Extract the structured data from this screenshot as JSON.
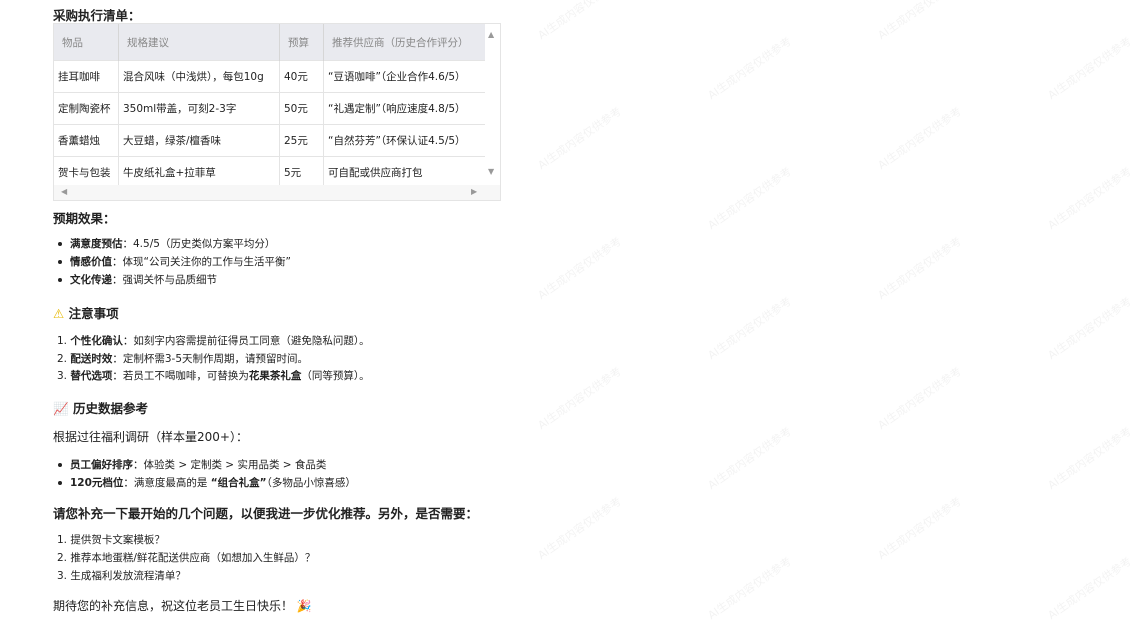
{
  "watermark": "AI生成内容仅供参考",
  "purchase": {
    "title": "采购执行清单：",
    "headers": [
      "物品",
      "规格建议",
      "预算",
      "推荐供应商（历史合作评分）"
    ],
    "rows": [
      [
        "挂耳咖啡",
        "混合风味（中浅烘），每包10g",
        "40元",
        "“豆语咖啡”（企业合作4.6/5）"
      ],
      [
        "定制陶瓷杯",
        "350ml带盖，可刻2-3字",
        "50元",
        "“礼遇定制”（响应速度4.8/5）"
      ],
      [
        "香薰蜡烛",
        "大豆蜡，绿茶/檀香味",
        "25元",
        "“自然芬芳”（环保认证4.5/5）"
      ],
      [
        "贺卡与包装",
        "牛皮纸礼盒+拉菲草",
        "5元",
        "可自配或供应商打包"
      ]
    ]
  },
  "effects": {
    "title": "预期效果：",
    "items": [
      {
        "label": "满意度预估",
        "text": "：4.5/5（历史类似方案平均分）"
      },
      {
        "label": "情感价值",
        "text": "：体现“公司关注你的工作与生活平衡”"
      },
      {
        "label": "文化传递",
        "text": "：强调关怀与品质细节"
      }
    ]
  },
  "notes": {
    "title": "注意事项",
    "items": [
      {
        "num": "1.",
        "label": "个性化确认",
        "text": "：如刻字内容需提前征得员工同意（避免隐私问题）。"
      },
      {
        "num": "2.",
        "label": "配送时效",
        "text": "：定制杯需3-5天制作周期，请预留时间。"
      },
      {
        "num": "3.",
        "label": "替代选项",
        "text": "：若员工不喝咖啡，可替换为",
        "bold2": "花果茶礼盒",
        "tail": "（同等预算）。"
      }
    ]
  },
  "history": {
    "title": "历史数据参考",
    "intro": "根据过往福利调研（样本量200+）：",
    "items": [
      {
        "label": "员工偏好排序",
        "text": "：体验类 > 定制类 > 实用品类 > 食品类"
      },
      {
        "label": "120元档位",
        "text": "：满意度最高的是 ",
        "bold2": "“组合礼盒”",
        "tail": "（多物品小惊喜感）"
      }
    ]
  },
  "question": {
    "title": "请您补充一下最开始的几个问题，以便我进一步优化推荐。另外，是否需要：",
    "items": [
      {
        "num": "1.",
        "text": "提供贺卡文案模板？"
      },
      {
        "num": "2.",
        "text": "推荐本地蛋糕/鲜花配送供应商（如想加入生鲜品）？"
      },
      {
        "num": "3.",
        "text": "生成福利发放流程清单？"
      }
    ]
  },
  "closing": "期待您的补充信息，祝这位老员工生日快乐！"
}
